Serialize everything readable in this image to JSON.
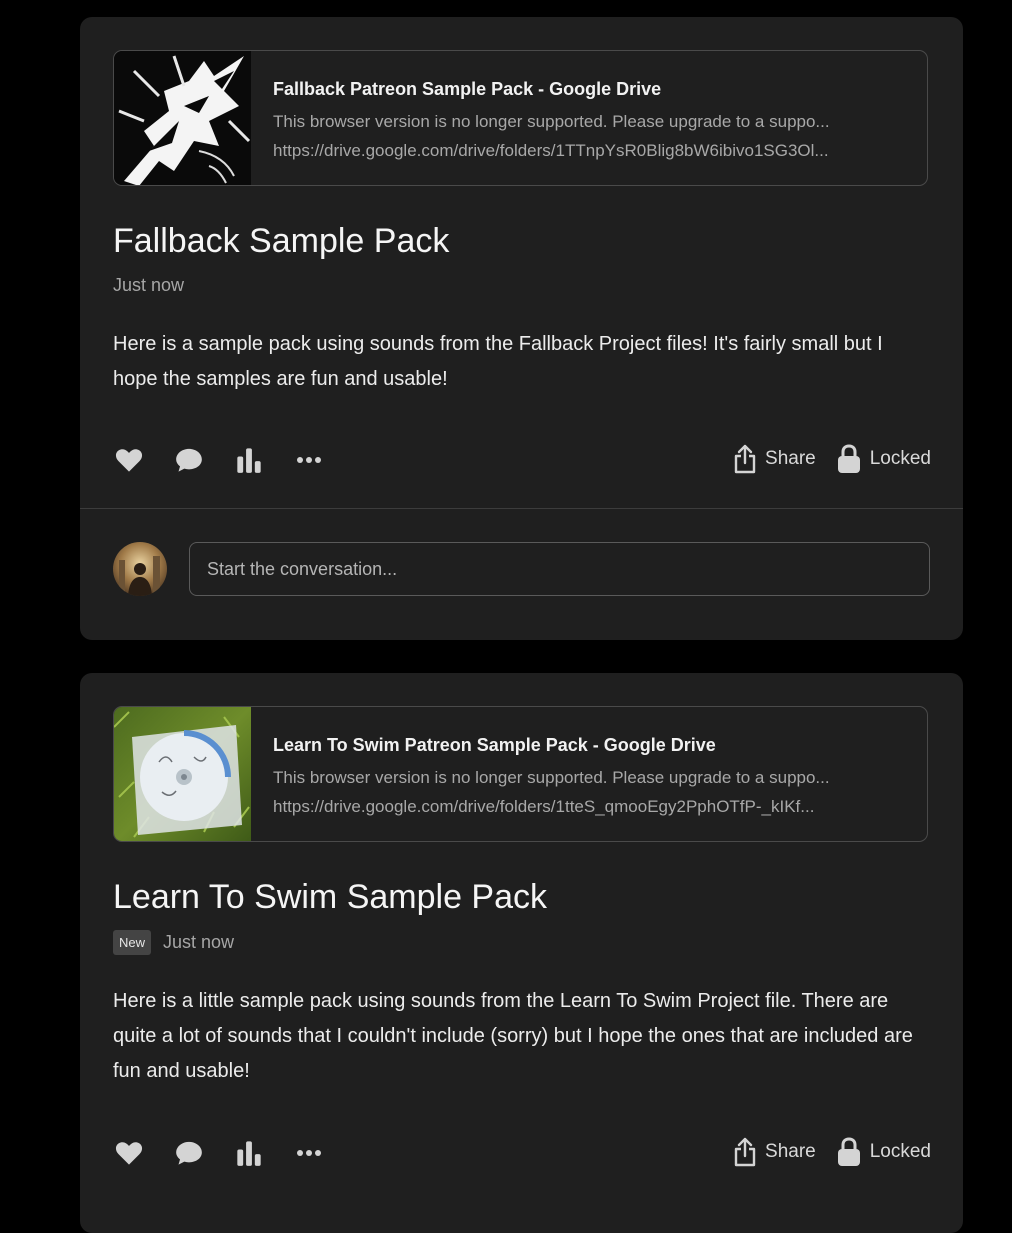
{
  "posts": [
    {
      "link_preview": {
        "title": "Fallback Patreon Sample Pack - Google Drive",
        "description": "This browser version is no longer supported. Please upgrade to a suppo...",
        "url": "https://drive.google.com/drive/folders/1TTnpYsR0Blig8bW6ibivo1SG3Ol..."
      },
      "title": "Fallback Sample Pack",
      "timestamp": "Just now",
      "body": "Here is a sample pack using sounds from the Fallback Project files! It's fairly small but I hope the samples are fun and usable!",
      "actions": {
        "share_label": "Share",
        "locked_label": "Locked"
      },
      "comment_placeholder": "Start the conversation..."
    },
    {
      "link_preview": {
        "title": "Learn To Swim Patreon Sample Pack - Google Drive",
        "description": "This browser version is no longer supported. Please upgrade to a suppo...",
        "url": "https://drive.google.com/drive/folders/1tteS_qmooEgy2PphOTfP-_kIKf..."
      },
      "title": "Learn To Swim Sample Pack",
      "badge": "New",
      "timestamp": "Just now",
      "body": "Here is a little sample pack using sounds from the Learn To Swim Project file. There are quite a lot of sounds that I couldn't include (sorry) but I hope the ones that are included are fun and usable!",
      "actions": {
        "share_label": "Share",
        "locked_label": "Locked"
      }
    }
  ],
  "icons": [
    "heart-icon",
    "comment-icon",
    "stats-icon",
    "more-icon",
    "share-icon",
    "lock-icon"
  ],
  "colors": {
    "page_bg": "#000000",
    "card_bg": "#1f1f1f",
    "border": "#4a4a4a",
    "muted_text": "#a6a6a6"
  }
}
